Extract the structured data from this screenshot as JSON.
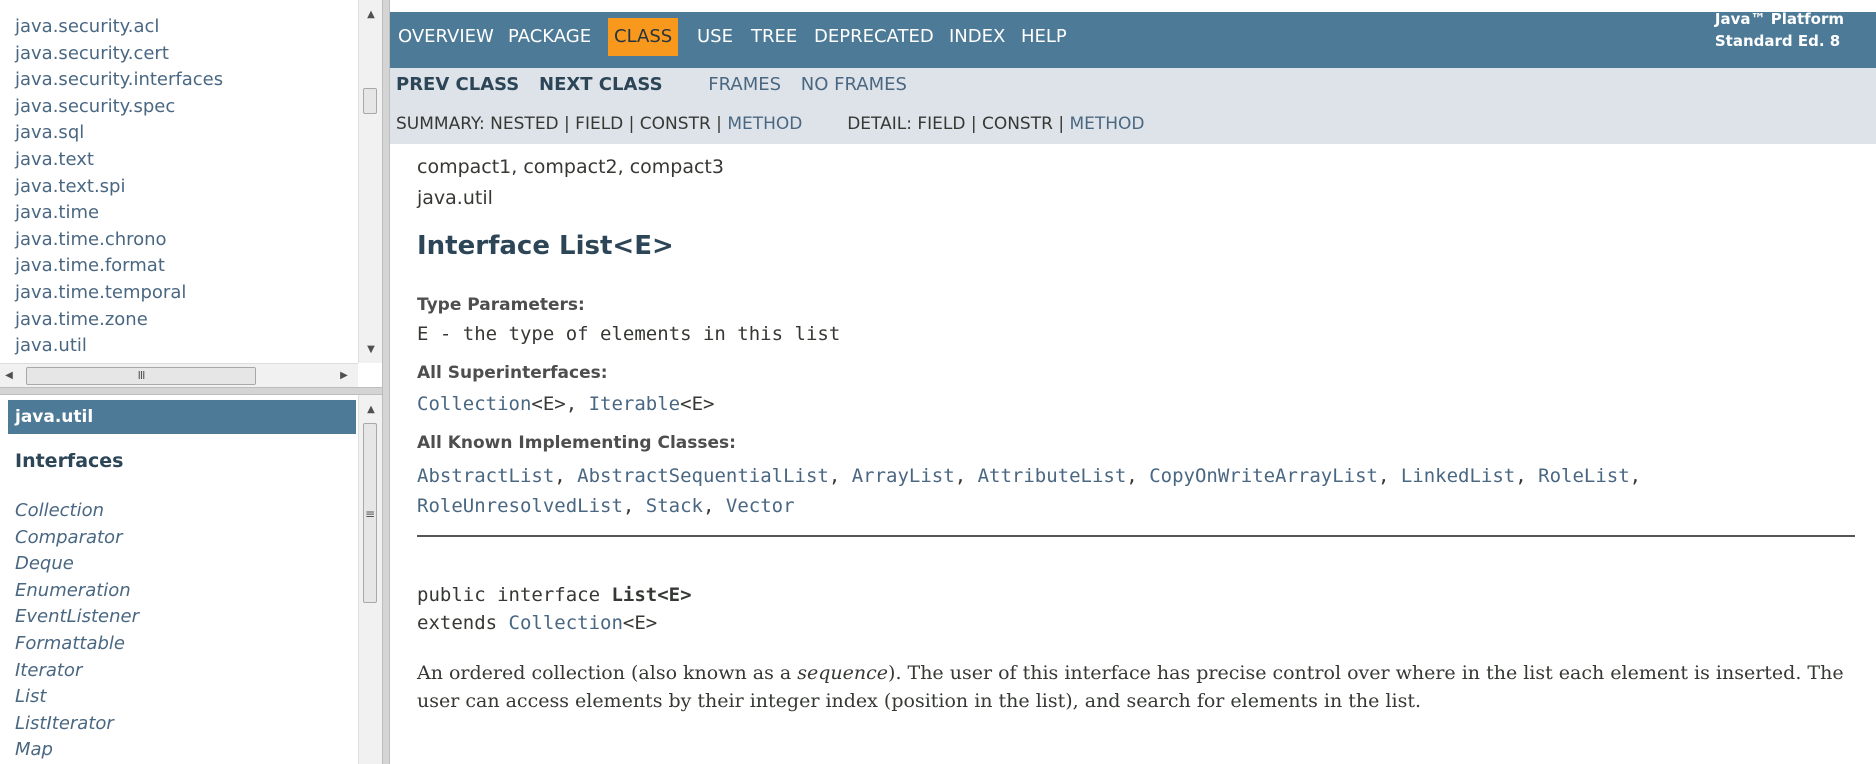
{
  "packages_frame": {
    "items": [
      "java.security.acl",
      "java.security.cert",
      "java.security.interfaces",
      "java.security.spec",
      "java.sql",
      "java.text",
      "java.text.spi",
      "java.time",
      "java.time.chrono",
      "java.time.format",
      "java.time.temporal",
      "java.time.zone",
      "java.util"
    ],
    "scroll_up_icon": "arrow-up-icon",
    "scroll_down_icon": "arrow-down-icon",
    "hscroll_grip": "III"
  },
  "classes_frame": {
    "header": "java.util",
    "section_title": "Interfaces",
    "items": [
      "Collection",
      "Comparator",
      "Deque",
      "Enumeration",
      "EventListener",
      "Formattable",
      "Iterator",
      "List",
      "ListIterator",
      "Map"
    ],
    "scroll_grip": "≡"
  },
  "top_nav": {
    "items": [
      "OVERVIEW",
      "PACKAGE",
      "CLASS",
      "USE",
      "TREE",
      "DEPRECATED",
      "INDEX",
      "HELP"
    ],
    "active": "CLASS",
    "about_line1": "Java™ Platform",
    "about_line2": "Standard Ed. 8"
  },
  "sub_nav": {
    "prev_class": "PREV CLASS",
    "next_class": "NEXT CLASS",
    "frames": "FRAMES",
    "no_frames": "NO FRAMES",
    "summary_label": "SUMMARY: NESTED | FIELD | CONSTR | ",
    "summary_method": "METHOD",
    "detail_label": "DETAIL: FIELD | CONSTR | ",
    "detail_method": "METHOD"
  },
  "main": {
    "profiles": "compact1, compact2, compact3",
    "package": "java.util",
    "title": "Interface List<E>",
    "type_params_label": "Type Parameters:",
    "type_param_name": "E",
    "type_param_desc": " - the type of elements in this list",
    "superinterfaces_label": "All Superinterfaces:",
    "superinterfaces": [
      "Collection",
      "Iterable"
    ],
    "generic_suffix": "<E>",
    "implementing_label": "All Known Implementing Classes:",
    "implementing_classes": [
      "AbstractList",
      "AbstractSequentialList",
      "ArrayList",
      "AttributeList",
      "CopyOnWriteArrayList",
      "LinkedList",
      "RoleList",
      "RoleUnresolvedList",
      "Stack",
      "Vector"
    ],
    "decl_prefix": "public interface ",
    "decl_name": "List<E>",
    "decl_extends": "extends ",
    "decl_extends_type": "Collection",
    "desc_part1": "An ordered collection (also known as a ",
    "desc_em": "sequence",
    "desc_part2": "). The user of this interface has precise control over where in the list each element is inserted. The user can access elements by their integer index (position in the list), and search for elements in the list."
  },
  "colors": {
    "nav_bar": "#4d7a97",
    "active_tab": "#f8981d",
    "sub_nav": "#dee3e9",
    "link": "#4a6782"
  }
}
